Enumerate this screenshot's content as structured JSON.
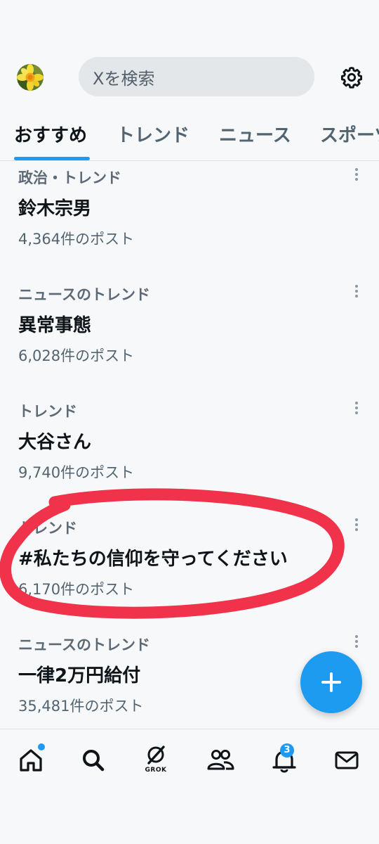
{
  "header": {
    "search": {
      "text": "Xを検索"
    },
    "avatar_icon": "daffodil-flower-avatar",
    "settings_icon": "gear-icon"
  },
  "tabs": [
    {
      "label": "おすすめ",
      "active": true
    },
    {
      "label": "トレンド",
      "active": false
    },
    {
      "label": "ニュース",
      "active": false
    },
    {
      "label": "スポーツ",
      "active": false
    }
  ],
  "trends": [
    {
      "category": "政治・トレンド",
      "title": "鈴木宗男",
      "count": "4,364件のポスト"
    },
    {
      "category": "ニュースのトレンド",
      "title": "異常事態",
      "count": "6,028件のポスト"
    },
    {
      "category": "トレンド",
      "title": "大谷さん",
      "count": "9,740件のポスト"
    },
    {
      "category": "トレンド",
      "title": "#私たちの信仰を守ってください",
      "count": "6,170件のポスト"
    },
    {
      "category": "ニュースのトレンド",
      "title": "一律2万円給付",
      "count": "35,481件のポスト"
    }
  ],
  "fab": {
    "icon": "plus-icon"
  },
  "bottom_nav": {
    "grok_label": "GROK",
    "notification_count": "3",
    "items": [
      "home-icon",
      "search-icon",
      "grok-icon",
      "communities-icon",
      "notifications-icon",
      "messages-icon"
    ]
  },
  "colors": {
    "accent": "#1d9bf0",
    "annotation": "#f0334a",
    "background": "#f7f8f9"
  }
}
